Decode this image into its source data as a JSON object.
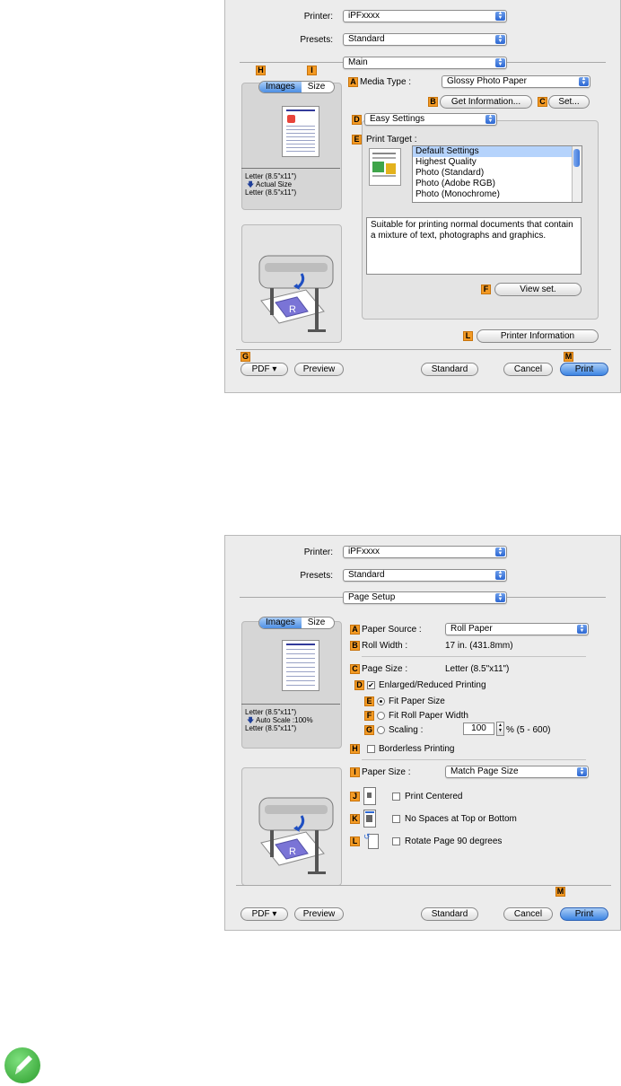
{
  "dialog1": {
    "printer_label": "Printer:",
    "printer_value": "iPFxxxx",
    "presets_label": "Presets:",
    "presets_value": "Standard",
    "pane_value": "Main",
    "tabs": [
      "Images",
      "Size"
    ],
    "size_info": [
      "Letter (8.5\"x11\")",
      "Actual Size",
      "Letter (8.5\"x11\")"
    ],
    "media_type_label": "Media Type :",
    "media_type_value": "Glossy Photo Paper",
    "get_info_label": "Get Information...",
    "set_label": "Set...",
    "easy_settings_value": "Easy Settings",
    "print_target_label": "Print Target :",
    "print_targets": [
      "Default Settings",
      "Highest Quality",
      "Photo (Standard)",
      "Photo (Adobe RGB)",
      "Photo (Monochrome)"
    ],
    "description": "Suitable for printing normal documents that contain a mixture of text, photographs and graphics.",
    "view_set_label": "View set.",
    "printer_info_label": "Printer Information",
    "pdf_label": "PDF ▾",
    "preview_label": "Preview",
    "standard_label": "Standard",
    "cancel_label": "Cancel",
    "print_label": "Print",
    "tags": {
      "A": "A",
      "B": "B",
      "C": "C",
      "D": "D",
      "E": "E",
      "F": "F",
      "G": "G",
      "H": "H",
      "I": "I",
      "L": "L",
      "M": "M"
    }
  },
  "dialog2": {
    "printer_label": "Printer:",
    "printer_value": "iPFxxxx",
    "presets_label": "Presets:",
    "presets_value": "Standard",
    "pane_value": "Page Setup",
    "tabs": [
      "Images",
      "Size"
    ],
    "size_info": [
      "Letter (8.5\"x11\")",
      "Auto Scale :100%",
      "Letter (8.5\"x11\")"
    ],
    "paper_source_label": "Paper Source :",
    "paper_source_value": "Roll Paper",
    "roll_width_label": "Roll Width :",
    "roll_width_value": "17 in. (431.8mm)",
    "page_size_label": "Page Size :",
    "page_size_value": "Letter (8.5\"x11\")",
    "enlarged_label": "Enlarged/Reduced Printing",
    "fit_paper_label": "Fit Paper Size",
    "fit_roll_label": "Fit Roll Paper Width",
    "scaling_label": "Scaling :",
    "scaling_value": "100",
    "scaling_range": "% (5 - 600)",
    "borderless_label": "Borderless Printing",
    "paper_size_label": "Paper Size :",
    "paper_size_value": "Match Page Size",
    "print_centered_label": "Print Centered",
    "no_spaces_label": "No Spaces at Top or Bottom",
    "rotate_label": "Rotate Page 90 degrees",
    "pdf_label": "PDF ▾",
    "preview_label": "Preview",
    "standard_label": "Standard",
    "cancel_label": "Cancel",
    "print_label": "Print",
    "tags": {
      "A": "A",
      "B": "B",
      "C": "C",
      "D": "D",
      "E": "E",
      "F": "F",
      "G": "G",
      "H": "H",
      "I": "I",
      "J": "J",
      "K": "K",
      "L": "L",
      "M": "M"
    }
  },
  "colors": {
    "accent": "#3c84e2",
    "tag": "#f39a24",
    "dialog_bg": "#ececec"
  }
}
